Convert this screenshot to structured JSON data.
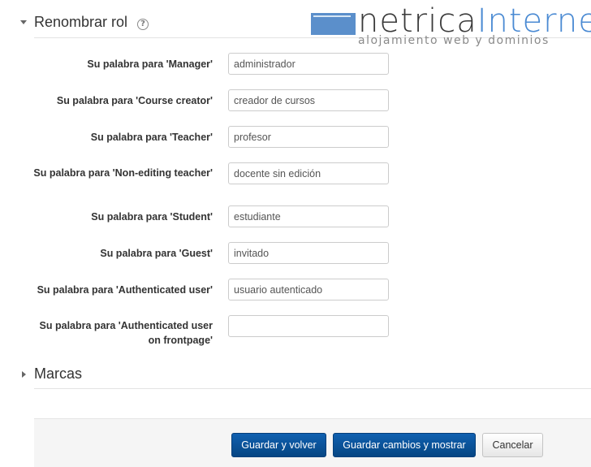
{
  "logo": {
    "name_part1": "netrica",
    "name_part2": "Internet",
    "tagline": "alojamiento web y dominios"
  },
  "section_renombrar": {
    "title": "Renombrar rol",
    "help_glyph": "?",
    "expanded": true
  },
  "fields": [
    {
      "label": "Su palabra para 'Manager'",
      "value": "administrador"
    },
    {
      "label": "Su palabra para 'Course creator'",
      "value": "creador de cursos"
    },
    {
      "label": "Su palabra para 'Teacher'",
      "value": "profesor"
    },
    {
      "label": "Su palabra para 'Non-editing teacher'",
      "value": "docente sin edición"
    },
    {
      "label": "Su palabra para 'Student'",
      "value": "estudiante"
    },
    {
      "label": "Su palabra para 'Guest'",
      "value": "invitado"
    },
    {
      "label": "Su palabra para 'Authenticated user'",
      "value": "usuario autenticado"
    },
    {
      "label": "Su palabra para 'Authenticated user on frontpage'",
      "value": ""
    }
  ],
  "section_marcas": {
    "title": "Marcas",
    "expanded": false
  },
  "buttons": {
    "save_return": "Guardar y volver",
    "save_display": "Guardar cambios y mostrar",
    "cancel": "Cancelar"
  },
  "colors": {
    "primary_button": "#0a4f95",
    "logo_blue": "#4a8ad3"
  }
}
